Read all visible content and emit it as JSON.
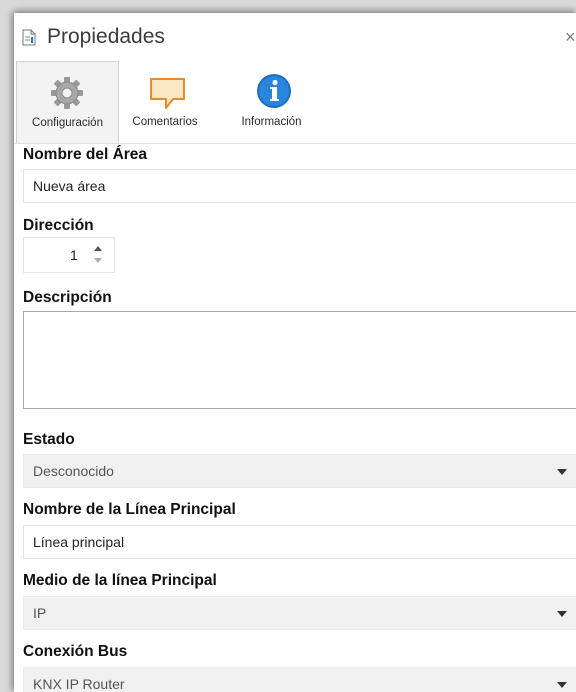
{
  "window": {
    "title": "Propiedades",
    "close_glyph": "×"
  },
  "tabs": [
    {
      "label": "Configuración",
      "icon": "gear-icon"
    },
    {
      "label": "Comentarios",
      "icon": "comment-icon"
    },
    {
      "label": "Información",
      "icon": "info-icon"
    }
  ],
  "form": {
    "area_name": {
      "label": "Nombre del Área",
      "value": "Nueva área"
    },
    "address": {
      "label": "Dirección",
      "value": "1"
    },
    "description": {
      "label": "Descripción",
      "value": ""
    },
    "status": {
      "label": "Estado",
      "value": "Desconocido"
    },
    "main_line_name": {
      "label": "Nombre de la Línea Principal",
      "value": "Línea principal"
    },
    "main_line_medium": {
      "label": "Medio de la línea Principal",
      "value": "IP"
    },
    "bus_connection": {
      "label": "Conexión Bus",
      "value": "KNX IP Router"
    }
  },
  "colors": {
    "accent_info": "#1e6fc2",
    "comment_fill": "#fbe7c6",
    "comment_stroke": "#e58b2c"
  }
}
